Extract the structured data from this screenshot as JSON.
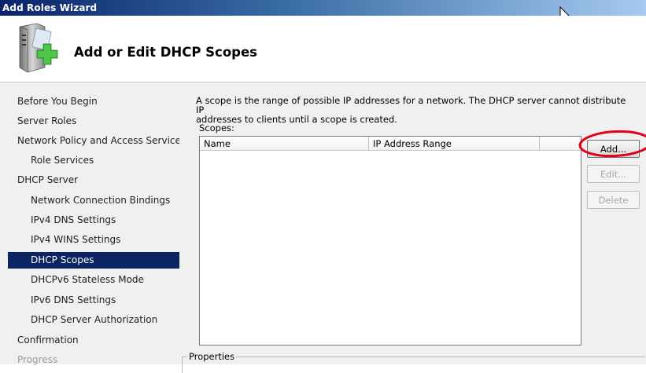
{
  "window": {
    "title": "Add Roles Wizard"
  },
  "header": {
    "page_title": "Add or Edit DHCP Scopes",
    "icon": "server-add-icon"
  },
  "sidebar": {
    "items": [
      {
        "label": "Before You Begin",
        "level": 0,
        "state": "normal"
      },
      {
        "label": "Server Roles",
        "level": 0,
        "state": "normal"
      },
      {
        "label": "Network Policy and Access Services",
        "level": 0,
        "state": "normal"
      },
      {
        "label": "Role Services",
        "level": 1,
        "state": "normal"
      },
      {
        "label": "DHCP Server",
        "level": 0,
        "state": "normal"
      },
      {
        "label": "Network Connection Bindings",
        "level": 1,
        "state": "normal"
      },
      {
        "label": "IPv4 DNS Settings",
        "level": 1,
        "state": "normal"
      },
      {
        "label": "IPv4 WINS Settings",
        "level": 1,
        "state": "normal"
      },
      {
        "label": "DHCP Scopes",
        "level": 1,
        "state": "selected"
      },
      {
        "label": "DHCPv6 Stateless Mode",
        "level": 1,
        "state": "normal"
      },
      {
        "label": "IPv6 DNS Settings",
        "level": 1,
        "state": "normal"
      },
      {
        "label": "DHCP Server Authorization",
        "level": 1,
        "state": "normal"
      },
      {
        "label": "Confirmation",
        "level": 0,
        "state": "normal"
      },
      {
        "label": "Progress",
        "level": 0,
        "state": "disabled"
      }
    ]
  },
  "main": {
    "description_line1": "A scope is the range of possible IP addresses for a network. The DHCP server cannot distribute IP",
    "description_line2": "addresses to clients until a scope is created.",
    "scopes_label": "Scopes:",
    "columns": [
      "Name",
      "IP Address Range",
      ""
    ],
    "rows": [],
    "buttons": {
      "add": "Add...",
      "edit": "Edit...",
      "delete": "Delete"
    },
    "properties_label": "Properties"
  },
  "colors": {
    "selected_background": "#0c2461",
    "title_bar": "#0a246a",
    "highlight_ring": "#e0001b"
  }
}
